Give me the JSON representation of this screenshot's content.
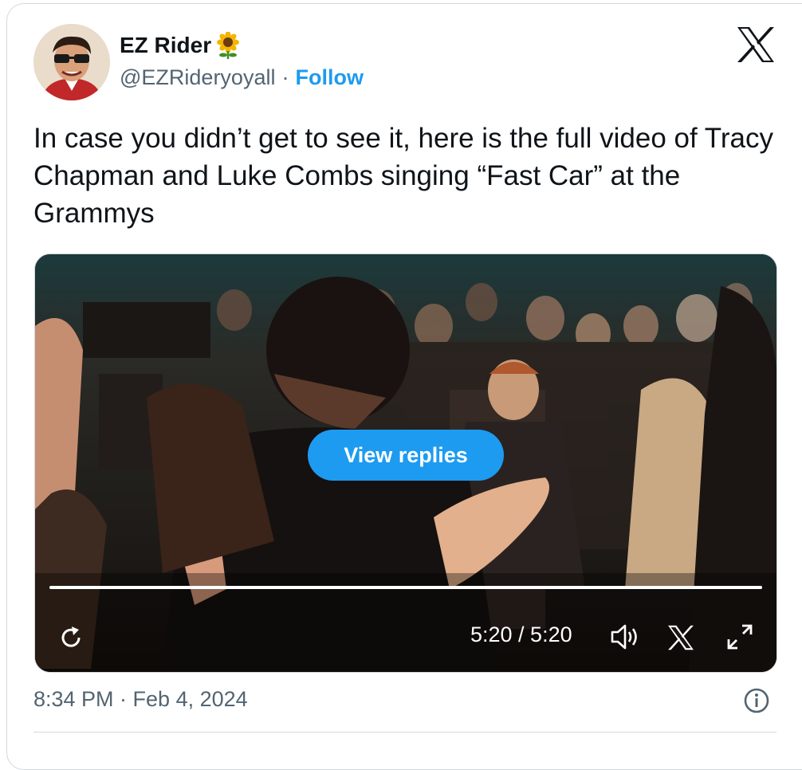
{
  "author": {
    "name": "EZ Rider",
    "name_emoji": "sunflower-emoji",
    "handle": "@EZRideryoyall",
    "separator": "·",
    "follow_label": "Follow"
  },
  "tweet": {
    "text": "In case you didn’t get to see it, here is the full video of Tracy Chapman and Luke Combs singing “Fast Car” at the Grammys",
    "timestamp": "8:34 PM · Feb 4, 2024"
  },
  "video": {
    "overlay_button": "View replies",
    "time_display": "5:20 / 5:20",
    "progress": 1.0,
    "icons": [
      "replay-icon",
      "volume-icon",
      "x-logo-icon",
      "fullscreen-icon"
    ]
  },
  "colors": {
    "accent": "#1d9bf0",
    "text_primary": "#0f1419",
    "text_secondary": "#536471",
    "border": "#cfd9de"
  }
}
